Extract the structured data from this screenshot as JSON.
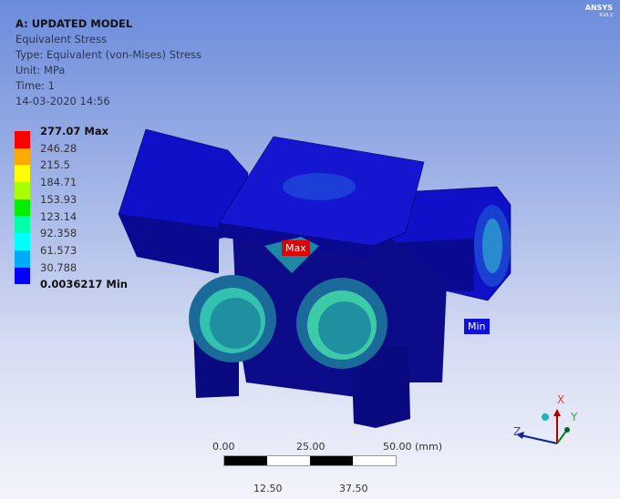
{
  "header": {
    "title": "A: UPDATED MODEL",
    "result": "Equivalent Stress",
    "type": "Type: Equivalent (von-Mises) Stress",
    "unit": "Unit: MPa",
    "time": "Time: 1",
    "date": "14-03-2020 14:56"
  },
  "brand": {
    "name": "ANSYS",
    "version": "R18.2"
  },
  "legend": [
    {
      "label": "277.07 Max",
      "color": "#ff0000"
    },
    {
      "label": "246.28",
      "color": "#ffaa00"
    },
    {
      "label": "215.5",
      "color": "#ffff00"
    },
    {
      "label": "184.71",
      "color": "#aaff00"
    },
    {
      "label": "153.93",
      "color": "#00ee00"
    },
    {
      "label": "123.14",
      "color": "#00ffaa"
    },
    {
      "label": "92.358",
      "color": "#00ffff"
    },
    {
      "label": "61.573",
      "color": "#00aaff"
    },
    {
      "label": "30.788",
      "color": "#0000ff"
    },
    {
      "label": "0.0036217 Min",
      "color": null
    }
  ],
  "probes": {
    "max": "Max",
    "min": "Min"
  },
  "scale_bar": {
    "t0": "0.00",
    "t1": "25.00",
    "t2": "50.00 (mm)",
    "b1": "12.50",
    "b2": "37.50"
  },
  "triad": {
    "x": "X",
    "y": "Y",
    "z": "Z"
  }
}
